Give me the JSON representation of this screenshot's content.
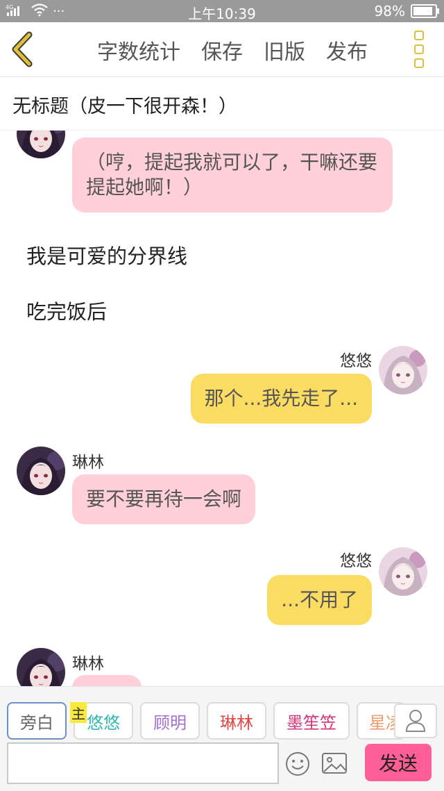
{
  "status_bar": {
    "network": "4G",
    "dots": "···",
    "time": "上午10:39",
    "battery": "98%",
    "battery_fraction": 0.98
  },
  "nav": {
    "actions": [
      "字数统计",
      "保存",
      "旧版",
      "发布"
    ]
  },
  "story_title": "无标题（皮一下很开森！）",
  "messages": [
    {
      "side": "left",
      "speaker": "",
      "text": "（哼，提起我就可以了，干嘛还要提起她啊！）",
      "color": "#ffd0da"
    },
    {
      "type": "narration",
      "text": "我是可爱的分界线"
    },
    {
      "type": "narration",
      "text": "吃完饭后"
    },
    {
      "side": "right",
      "speaker": "悠悠",
      "text": "那个...我先走了...",
      "color": "#fbdc62"
    },
    {
      "side": "left",
      "speaker": "琳林",
      "text": "要不要再待一会啊",
      "color": "#ffd0da"
    },
    {
      "side": "right",
      "speaker": "悠悠",
      "text": "...不用了",
      "color": "#fbdc62"
    },
    {
      "side": "left",
      "speaker": "琳林",
      "text": "",
      "color": "#ffd0da"
    }
  ],
  "characters": [
    {
      "label": "旁白",
      "color": "#666666",
      "active": true
    },
    {
      "label": "悠悠",
      "color": "#2fb8b0",
      "badge": "主"
    },
    {
      "label": "顾明",
      "color": "#a46ed3"
    },
    {
      "label": "琳林",
      "color": "#e04848"
    },
    {
      "label": "墨笙笠",
      "color": "#d4367d"
    },
    {
      "label": "星凌",
      "color": "#f09a6a"
    }
  ],
  "input": {
    "value": "",
    "placeholder": ""
  },
  "send_label": "发送",
  "colors": {
    "accent": "#fbdc62",
    "pink_bubble": "#ffd0da",
    "send_button": "#ff5f96",
    "back_arrow": "#e0bf3a"
  }
}
